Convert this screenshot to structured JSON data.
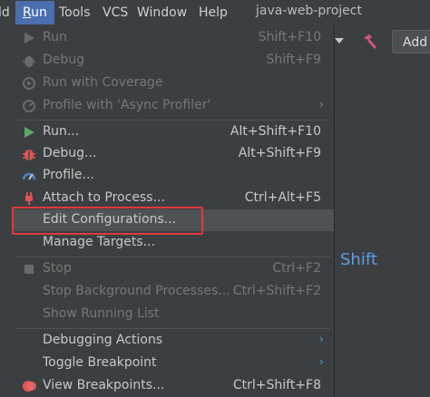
{
  "menubar": {
    "items": [
      {
        "label": "ld"
      },
      {
        "label": "Run"
      },
      {
        "label": "Tools"
      },
      {
        "label": "VCS"
      },
      {
        "label": "Window"
      },
      {
        "label": "Help"
      }
    ],
    "project_title": "java-web-project"
  },
  "toolbar": {
    "add_label": "Add",
    "icons": [
      "run-config-dropdown-icon",
      "build-hammer-icon"
    ]
  },
  "background_text": {
    "shift": "Shift"
  },
  "menu": {
    "items": [
      {
        "label": "Run",
        "shortcut": "Shift+F10",
        "enabled": false,
        "icon": "run-icon"
      },
      {
        "label": "Debug",
        "shortcut": "Shift+F9",
        "enabled": false,
        "icon": "debug-icon"
      },
      {
        "label": "Run with Coverage",
        "shortcut": "",
        "enabled": false,
        "icon": "coverage-icon"
      },
      {
        "label": "Profile with 'Async Profiler'",
        "shortcut": "",
        "enabled": false,
        "icon": "profiler-icon",
        "submenu": true
      },
      {
        "label": "Run...",
        "shortcut": "Alt+Shift+F10",
        "enabled": true,
        "icon": "run-icon"
      },
      {
        "label": "Debug...",
        "shortcut": "Alt+Shift+F9",
        "enabled": true,
        "icon": "debug-icon"
      },
      {
        "label": "Profile...",
        "shortcut": "",
        "enabled": true,
        "icon": "profile-gauge-icon"
      },
      {
        "label": "Attach to Process...",
        "shortcut": "Ctrl+Alt+F5",
        "enabled": true,
        "icon": "attach-plug-icon"
      },
      {
        "label": "Edit Configurations...",
        "shortcut": "",
        "enabled": true,
        "selected": true
      },
      {
        "label": "Manage Targets...",
        "shortcut": "",
        "enabled": true
      },
      {
        "label": "Stop",
        "shortcut": "Ctrl+F2",
        "enabled": false,
        "icon": "stop-icon"
      },
      {
        "label": "Stop Background Processes...",
        "shortcut": "Ctrl+Shift+F2",
        "enabled": false
      },
      {
        "label": "Show Running List",
        "shortcut": "",
        "enabled": false
      },
      {
        "label": "Debugging Actions",
        "shortcut": "",
        "enabled": true,
        "submenu": true
      },
      {
        "label": "Toggle Breakpoint",
        "shortcut": "",
        "enabled": true,
        "submenu": true
      },
      {
        "label": "View Breakpoints...",
        "shortcut": "Ctrl+Shift+F8",
        "enabled": true,
        "icon": "breakpoints-icon"
      }
    ]
  },
  "colors": {
    "background": "#3c3f41",
    "active_menu": "#4b6eaf",
    "run_green": "#59a869",
    "debug_red": "#e05555",
    "highlight_border": "#e0393f",
    "link_blue": "#5c9ee0"
  }
}
